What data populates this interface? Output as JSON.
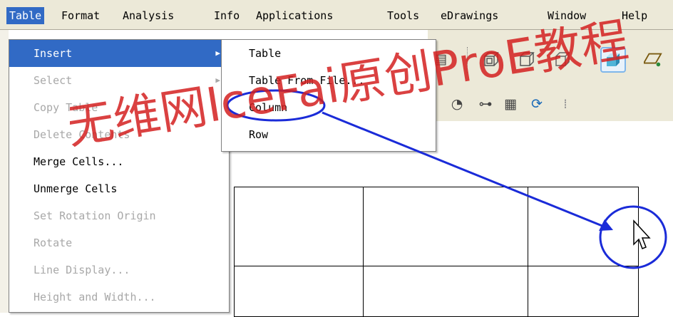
{
  "menubar": {
    "items": [
      {
        "label": "Table",
        "active": true
      },
      {
        "label": "Format"
      },
      {
        "label": "Analysis"
      },
      {
        "label": "Info"
      },
      {
        "label": "Applications"
      },
      {
        "label": "Tools"
      },
      {
        "label": "eDrawings"
      },
      {
        "label": "Window"
      },
      {
        "label": "Help"
      }
    ]
  },
  "table_menu": {
    "items": [
      {
        "label": "Insert",
        "state": "highlighted",
        "submenu": true
      },
      {
        "label": "Select",
        "state": "disabled",
        "submenu": true
      },
      {
        "label": "Copy Table",
        "state": "disabled"
      },
      {
        "label": "Delete Contents",
        "state": "disabled"
      },
      {
        "label": "Merge Cells...",
        "state": "enabled"
      },
      {
        "label": "Unmerge Cells",
        "state": "enabled"
      },
      {
        "label": "Set Rotation Origin",
        "state": "disabled"
      },
      {
        "label": "Rotate",
        "state": "disabled"
      },
      {
        "label": "Line Display...",
        "state": "disabled"
      },
      {
        "label": "Height and Width...",
        "state": "disabled"
      }
    ]
  },
  "insert_submenu": {
    "items": [
      {
        "label": "Table"
      },
      {
        "label": "Table From File..."
      },
      {
        "label": "Column"
      },
      {
        "label": "Row"
      }
    ]
  },
  "toolbar": {
    "icons": [
      "view-icon",
      "cube-wireframe-icon",
      "cube-wireframe-icon",
      "cube-hidden-icon",
      "cube-shaded-icon",
      "plane-icon",
      "display-style-icon",
      "tree-icon",
      "table-icon",
      "regenerate-icon",
      "grid-icon"
    ]
  },
  "watermark": {
    "text": "无维网IceFai原创ProE教程",
    "color": "#d32020"
  },
  "annotation": {
    "color": "#1a2bd8"
  }
}
